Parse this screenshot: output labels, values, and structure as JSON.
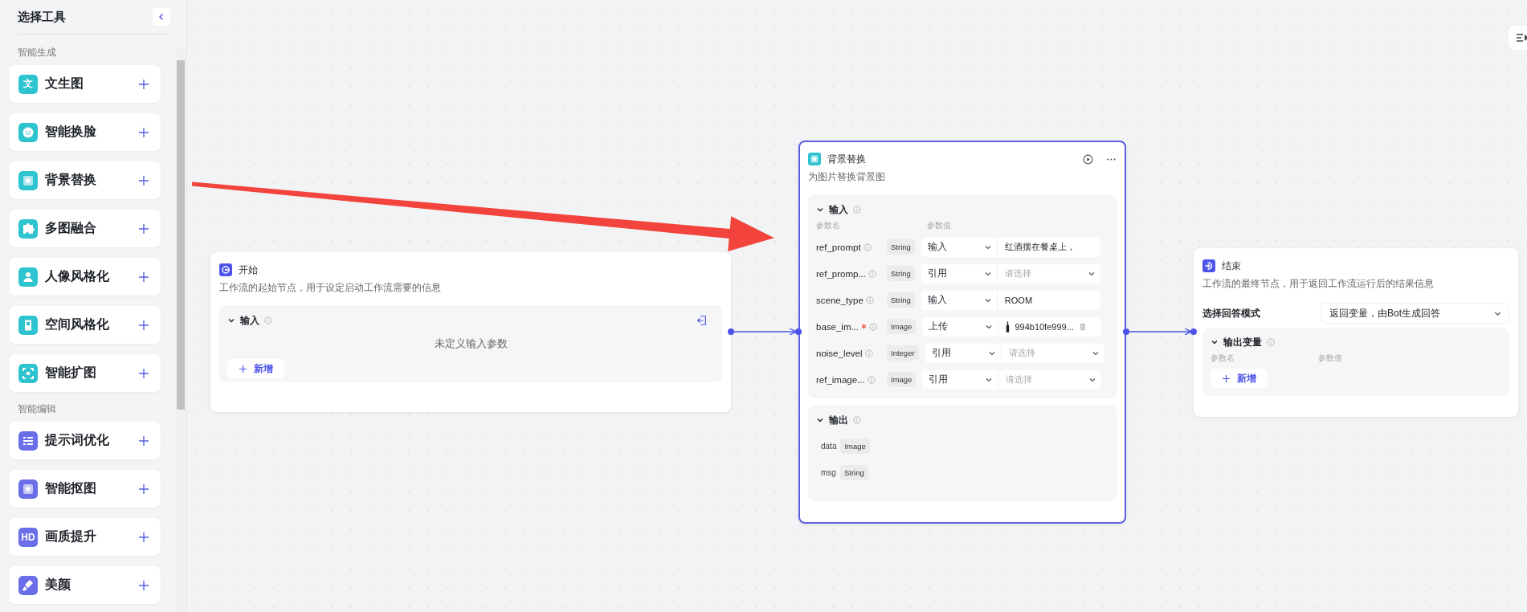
{
  "sidebar": {
    "title": "选择工具",
    "sections": [
      {
        "label": "智能生成",
        "color": "#2ec4cf",
        "items": [
          {
            "label": "文生图",
            "kind": "text",
            "icon_text": "文"
          },
          {
            "label": "智能换脸",
            "kind": "face"
          },
          {
            "label": "背景替换",
            "kind": "star"
          },
          {
            "label": "多图融合",
            "kind": "puzzle"
          },
          {
            "label": "人像风格化",
            "kind": "person"
          },
          {
            "label": "空间风格化",
            "kind": "door"
          },
          {
            "label": "智能扩图",
            "kind": "expand"
          }
        ]
      },
      {
        "label": "智能编辑",
        "color": "#6b6ee8",
        "items": [
          {
            "label": "提示词优化",
            "kind": "list"
          },
          {
            "label": "智能抠图",
            "kind": "star"
          },
          {
            "label": "画质提升",
            "kind": "text",
            "icon_text": "HD"
          },
          {
            "label": "美颜",
            "kind": "brush"
          }
        ]
      }
    ]
  },
  "start_node": {
    "title": "开始",
    "description": "工作流的起始节点，用于设定启动工作流需要的信息",
    "selected": false,
    "input": {
      "label": "输入",
      "expanded": true,
      "empty_text": "未定义输入参数",
      "add_button": "新增"
    }
  },
  "tool_node": {
    "title": "背景替换",
    "description": "为图片替换背景图",
    "selected": true,
    "input": {
      "label": "输入",
      "expanded": true,
      "col_name": "参数名",
      "col_value": "参数值",
      "rows": [
        {
          "name": "ref_prompt",
          "required": false,
          "type": "String",
          "source": "输入",
          "kind": "text",
          "value": "红酒摆在餐桌上，"
        },
        {
          "name": "ref_promp...",
          "required": false,
          "type": "String",
          "source": "引用",
          "kind": "select",
          "placeholder": "请选择"
        },
        {
          "name": "scene_type",
          "required": false,
          "type": "String",
          "source": "输入",
          "kind": "text",
          "value": "ROOM"
        },
        {
          "name": "base_im...",
          "required": true,
          "type": "Image",
          "source": "上传",
          "kind": "file",
          "file_name": "994b10fe999..."
        },
        {
          "name": "noise_level",
          "required": false,
          "type": "Integer",
          "source": "引用",
          "kind": "select",
          "placeholder": "请选择"
        },
        {
          "name": "ref_image...",
          "required": false,
          "type": "Image",
          "source": "引用",
          "kind": "select",
          "placeholder": "请选择"
        }
      ]
    },
    "output": {
      "label": "输出",
      "expanded": true,
      "rows": [
        {
          "name": "data",
          "type": "Image"
        },
        {
          "name": "msg",
          "type": "String"
        }
      ]
    }
  },
  "end_node": {
    "title": "结束",
    "description": "工作流的最终节点，用于返回工作流运行后的结果信息",
    "selected": false,
    "mode_label": "选择回答模式",
    "mode_value": "返回变量，由Bot生成回答",
    "output": {
      "label": "输出变量",
      "expanded": true,
      "col_name": "参数名",
      "col_value": "参数值",
      "add_button": "新增"
    }
  }
}
